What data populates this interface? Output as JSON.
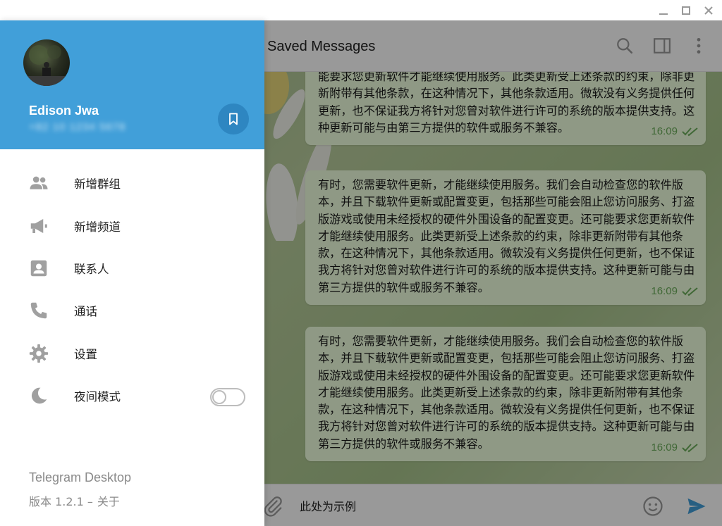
{
  "window": {
    "controls": {
      "minimize": "minimize-icon",
      "maximize": "maximize-icon",
      "close": "close-icon"
    }
  },
  "chat": {
    "title": "Saved Messages",
    "header_icons": [
      "search-icon",
      "sidebar-toggle-icon",
      "more-vert-icon"
    ],
    "messages": [
      {
        "text": "能要求您更新软件才能继续使用服务。此类更新受上述条款的约束，除非更新附带有其他条款，在这种情况下，其他条款适用。微软没有义务提供任何更新，也不保证我方将针对您曾对软件进行许可的系统的版本提供支持。这种更新可能与由第三方提供的软件或服务不兼容。",
        "time": "16:09"
      },
      {
        "text": "有时，您需要软件更新，才能继续使用服务。我们会自动检查您的软件版本，并且下载软件更新或配置变更，包括那些可能会阻止您访问服务、打盗版游戏或使用未经授权的硬件外围设备的配置变更。还可能要求您更新软件才能继续使用服务。此类更新受上述条款的约束，除非更新附带有其他条款，在这种情况下，其他条款适用。微软没有义务提供任何更新，也不保证我方将针对您曾对软件进行许可的系统的版本提供支持。这种更新可能与由第三方提供的软件或服务不兼容。",
        "time": "16:09"
      },
      {
        "text": "有时，您需要软件更新，才能继续使用服务。我们会自动检查您的软件版本，并且下载软件更新或配置变更，包括那些可能会阻止您访问服务、打盗版游戏或使用未经授权的硬件外围设备的配置变更。还可能要求您更新软件才能继续使用服务。此类更新受上述条款的约束，除非更新附带有其他条款，在这种情况下，其他条款适用。微软没有义务提供任何更新，也不保证我方将针对您曾对软件进行许可的系统的版本提供支持。这种更新可能与由第三方提供的软件或服务不兼容。",
        "time": "16:09"
      }
    ],
    "input": {
      "value": "此处为示例",
      "placeholder": ""
    }
  },
  "menu": {
    "user": {
      "name": "Edison Jwa",
      "phone": "+82 10 1234 5678"
    },
    "items": [
      {
        "label": "新增群组",
        "icon": "group-icon"
      },
      {
        "label": "新增频道",
        "icon": "megaphone-icon"
      },
      {
        "label": "联系人",
        "icon": "contact-icon"
      },
      {
        "label": "通话",
        "icon": "phone-icon"
      },
      {
        "label": "设置",
        "icon": "gear-icon"
      },
      {
        "label": "夜间模式",
        "icon": "moon-icon",
        "toggle": false
      }
    ],
    "footer": {
      "app_name": "Telegram Desktop",
      "version": "版本 1.2.1 –",
      "about": "关于"
    }
  },
  "colors": {
    "accent": "#419fd9",
    "bubble": "#eeffde",
    "check": "#6cad5a"
  }
}
